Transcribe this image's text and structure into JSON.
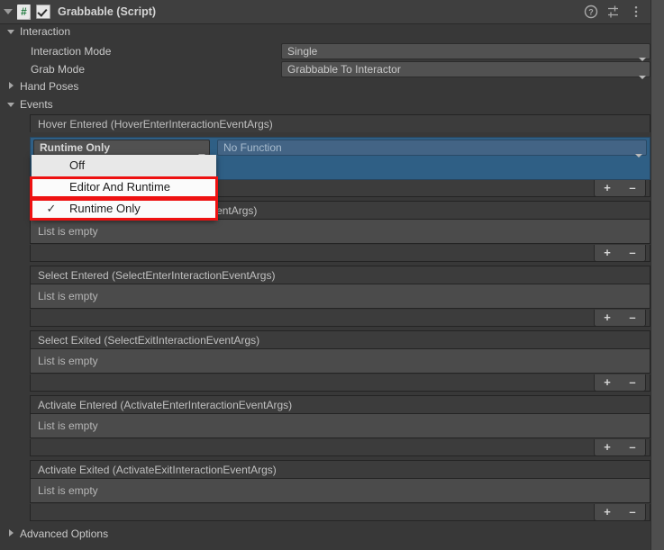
{
  "component": {
    "title": "Grabbable (Script)",
    "enabled": true,
    "icon": "csharp-script-icon",
    "hash_glyph": "#",
    "header_icons": [
      "help-icon",
      "preset-icon",
      "more-menu-icon"
    ]
  },
  "sections": {
    "interaction": {
      "label": "Interaction",
      "expanded": true,
      "fields": [
        {
          "label": "Interaction Mode",
          "value": "Single"
        },
        {
          "label": "Grab Mode",
          "value": "Grabbable To Interactor"
        }
      ]
    },
    "hand_poses": {
      "label": "Hand Poses",
      "expanded": false
    },
    "events": {
      "label": "Events",
      "expanded": true
    },
    "advanced_options": {
      "label": "Advanced Options",
      "expanded": false
    }
  },
  "events": [
    {
      "title": "Hover Entered (HoverEnterInteractionEventArgs)",
      "has_callback": true,
      "callback": {
        "lifetime": "Runtime Only",
        "function": "No Function"
      },
      "empty_text": ""
    },
    {
      "title": "Hover Exited (HoverExitInteractionEventArgs)",
      "partial_title": "EventArgs)",
      "has_callback": false,
      "empty_text": "List is empty"
    },
    {
      "title": "Select Entered (SelectEnterInteractionEventArgs)",
      "has_callback": false,
      "empty_text": "List is empty"
    },
    {
      "title": "Select Exited (SelectExitInteractionEventArgs)",
      "has_callback": false,
      "empty_text": "List is empty"
    },
    {
      "title": "Activate Entered (ActivateEnterInteractionEventArgs)",
      "has_callback": false,
      "empty_text": "List is empty"
    },
    {
      "title": "Activate Exited (ActivateExitInteractionEventArgs)",
      "has_callback": false,
      "empty_text": "List is empty"
    }
  ],
  "list_buttons": {
    "add": "+",
    "remove": "–"
  },
  "dropdown_popup": {
    "open": true,
    "items": [
      {
        "label": "Off",
        "checked": false,
        "hovered": true,
        "highlighted": false
      },
      {
        "label": "Editor And Runtime",
        "checked": false,
        "hovered": false,
        "highlighted": true
      },
      {
        "label": "Runtime Only",
        "checked": true,
        "hovered": false,
        "highlighted": true
      }
    ],
    "check_glyph": "✓"
  },
  "colors": {
    "background": "#383838",
    "header": "#3f3f3f",
    "field": "#515151",
    "event_body": "#4b4b4b",
    "selection_blue": "#2f5f85",
    "annotation_red": "#ee1111",
    "popup_background": "#fbfbfb"
  }
}
